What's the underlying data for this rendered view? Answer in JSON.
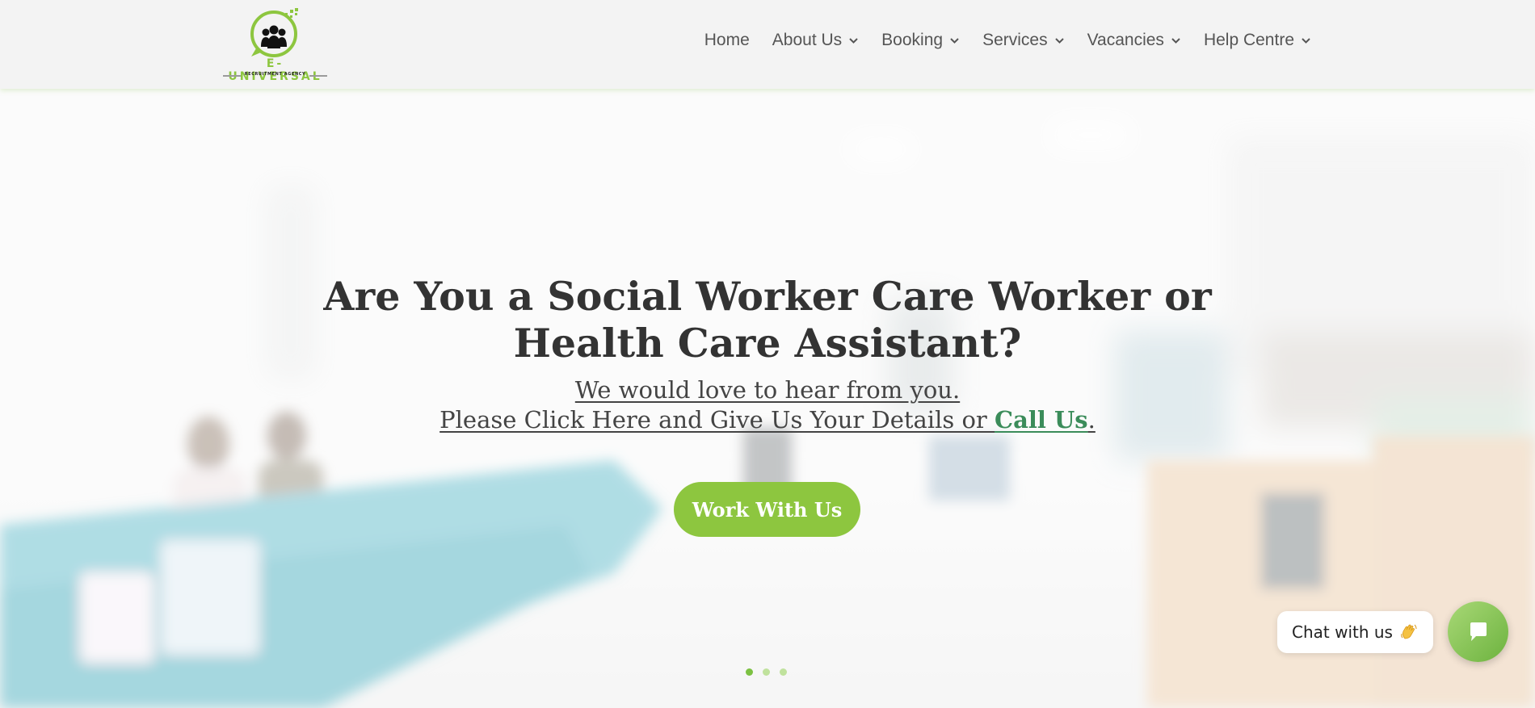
{
  "logo": {
    "brand": "E-UNIVERSAL",
    "tagline": "RECRUITMENT AGENCY",
    "icon": "people-chat-icon"
  },
  "nav": {
    "items": [
      {
        "label": "Home",
        "has_dropdown": false
      },
      {
        "label": "About Us",
        "has_dropdown": true
      },
      {
        "label": "Booking",
        "has_dropdown": true
      },
      {
        "label": "Services",
        "has_dropdown": true
      },
      {
        "label": "Vacancies",
        "has_dropdown": true
      },
      {
        "label": "Help Centre",
        "has_dropdown": true
      }
    ]
  },
  "hero": {
    "headline_line1": "Are You a Social Worker Care Worker or",
    "headline_line2": "Health Care Assistant?",
    "sub_line1": "We would love to hear from you.",
    "sub_line2_prefix": "Please Click Here and Give Us Your Details or ",
    "sub_line2_link": "Call Us",
    "sub_line2_suffix": ".",
    "cta_label": "Work With Us",
    "slides": 3,
    "active_slide": 1
  },
  "chat": {
    "bubble_text": "Chat with us",
    "wave_icon": "waving-hand-icon",
    "button_icon": "chat-icon"
  },
  "colors": {
    "accent": "#8dc63f",
    "link": "#3b8c5a",
    "text": "#333333",
    "header_bg": "#f3f3f3"
  }
}
